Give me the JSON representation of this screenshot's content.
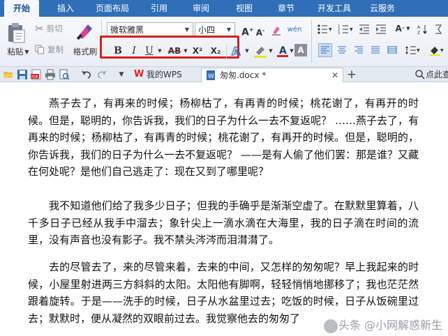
{
  "menu": {
    "tabs": [
      "开始",
      "插入",
      "页面布局",
      "引用",
      "审阅",
      "视图",
      "章节",
      "开发工具",
      "云服务"
    ],
    "active": "开始"
  },
  "clipboard": {
    "paste": "粘贴",
    "cut": "剪切",
    "copy": "复制",
    "format_painter": "格式刷"
  },
  "font": {
    "family": "微软雅黑",
    "size": "小四"
  },
  "font_buttons": {
    "bold": "B",
    "italic": "I",
    "underline": "U",
    "strike": "AB",
    "superscript": "X²",
    "subscript": "X₂",
    "grow": "A",
    "shrink": "A"
  },
  "doc_tabs": {
    "home": "我的WPS",
    "current": "匆匆.docx *",
    "search_hint": "点此查"
  },
  "document": {
    "paragraphs": [
      "燕子去了，有再来的时候；杨柳枯了，有再青的时候；桃花谢了，有再开的时候。但是，聪明的，你告诉我，我们的日子为什么一去不复返呢？ ……燕子去了，有再来的时候；杨柳枯了，有再青的时候；桃花谢了，有再开的时候。但是，聪明的，你告诉我，我们的日子为什么一去不复返呢？ ——是有人偷了他们罢：那是谁？又藏在何处呢？是他们自己逃走了：现在又到了哪里呢？",
      "我不知道他们给了我多少日子；但我的手确乎是渐渐空虚了。在默默里算着，八千多日子已经从我手中溜去；象针尖上一滴水滴在大海里，我的日子滴在时间的流里，没有声音也没有影子。我不禁头涔涔而泪潸潸了。",
      "去的尽管去了，来的尽管来着，去来的中间，又怎样的匆匆呢？早上我起来的时候，小屋里射进两三方斜斜的太阳。太阳他有脚啊，轻轻悄悄地挪移了；我也茫茫然跟着旋转。于是——洗手的时候，日子从水盆里过去；吃饭的时候，日子从饭碗里过去；默默时，便从凝然的双眼前过去。我觉察他去的匆匆了"
    ]
  },
  "watermark": "头条 @小网解惑新生",
  "colors": {
    "menu_bar": "#2f6fb8",
    "highlight_box": "#d81e1e",
    "font_color_bar": "#d81e1e",
    "highlight_color_bar": "#f2e21a",
    "wps_logo": "#d8262a",
    "doc_icon": "#2f6fb8"
  }
}
